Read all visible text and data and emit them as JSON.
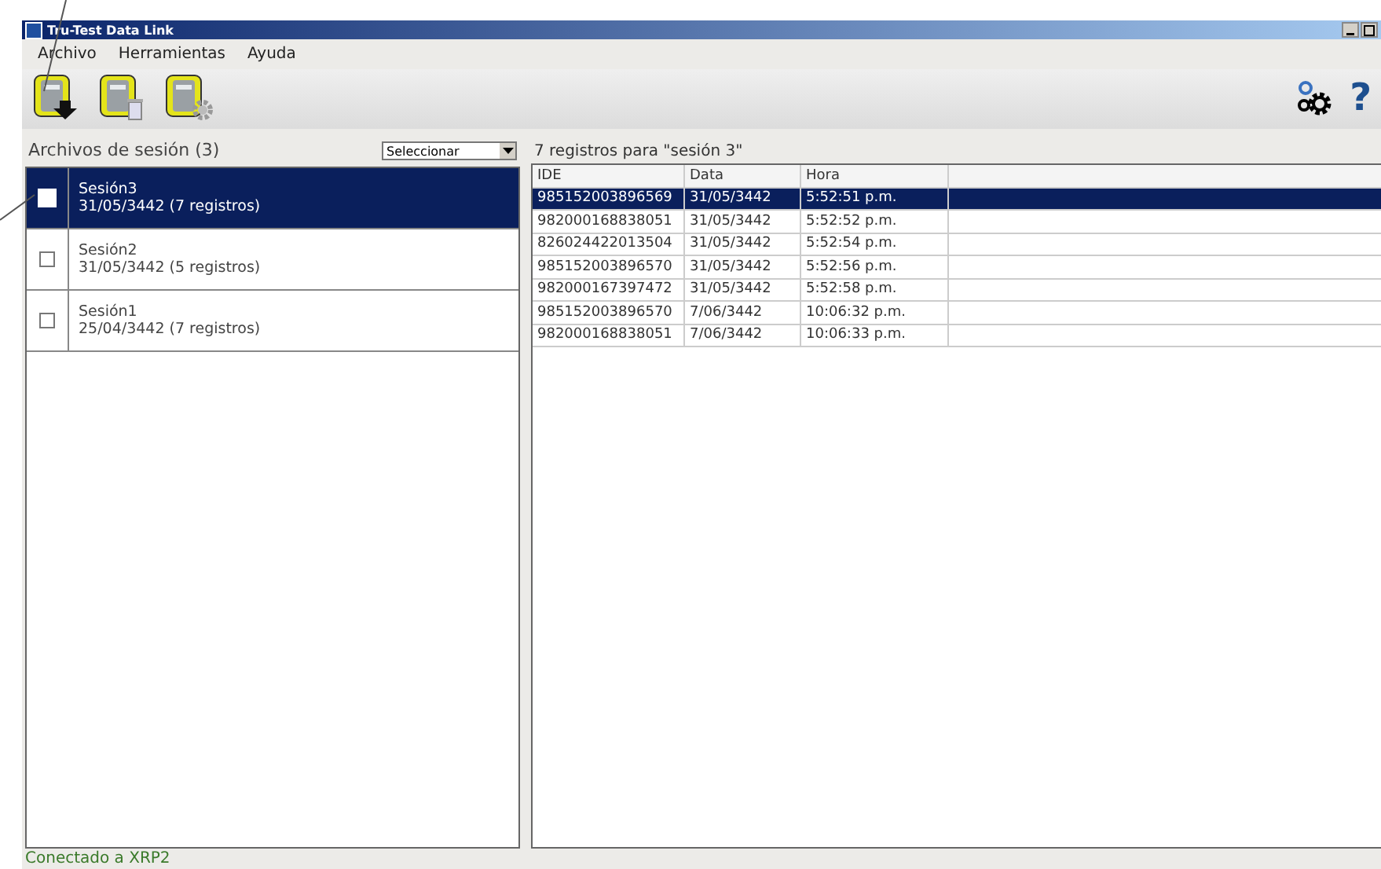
{
  "window": {
    "title": "Tru-Test Data Link"
  },
  "menu": [
    "Archivo",
    "Herramientas",
    "Ayuda"
  ],
  "toolbar": [
    {
      "kind": "download"
    },
    {
      "kind": "delete"
    },
    {
      "kind": "settings"
    }
  ],
  "help_button": "?",
  "sessions": {
    "title": "Archivos de sesión (3)",
    "select": "Seleccionar",
    "items": [
      {
        "name": "Sesión3",
        "detail": "31/05/3442  (7 registros)",
        "selected": true,
        "checked": false
      },
      {
        "name": "Sesión2",
        "detail": "31/05/3442  (5 registros)",
        "selected": false,
        "checked": false
      },
      {
        "name": "Sesión1",
        "detail": "25/04/3442  (7 registros)",
        "selected": false,
        "checked": false
      }
    ]
  },
  "records": {
    "title": "7 registros para \"sesión 3\"",
    "columns": [
      "IDE",
      "Data",
      "Hora"
    ],
    "rows": [
      {
        "cells": [
          "985152003896569",
          "31/05/3442",
          "5:52:51 p.m."
        ],
        "selected": true
      },
      {
        "cells": [
          "982000168838051",
          "31/05/3442",
          "5:52:52 p.m."
        ],
        "selected": false
      },
      {
        "cells": [
          "826024422013504",
          "31/05/3442",
          "5:52:54 p.m."
        ],
        "selected": false
      },
      {
        "cells": [
          "985152003896570",
          "31/05/3442",
          "5:52:56 p.m."
        ],
        "selected": false
      },
      {
        "cells": [
          "982000167397472",
          "31/05/3442",
          "5:52:58 p.m."
        ],
        "selected": false
      },
      {
        "cells": [
          "985152003896570",
          "7/06/3442",
          "10:06:32 p.m."
        ],
        "selected": false
      },
      {
        "cells": [
          "982000168838051",
          "7/06/3442",
          "10:06:33 p.m."
        ],
        "selected": false
      }
    ]
  },
  "status_bar": "Conectado a XRP2"
}
